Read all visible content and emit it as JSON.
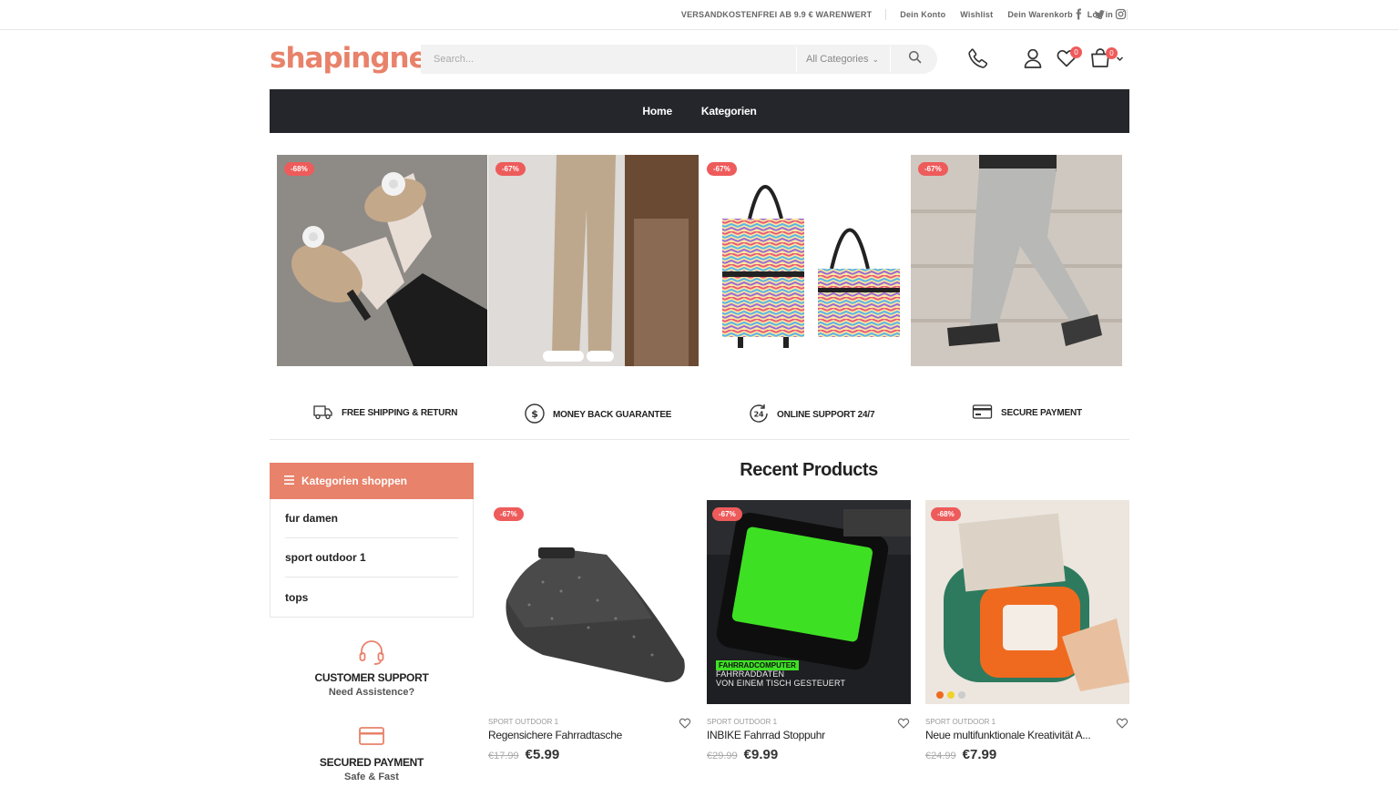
{
  "topbar": {
    "shipping_notice": "VERSANDKOSTENFREI AB 9.9 € WARENWERT",
    "links": [
      "Dein Konto",
      "Wishlist",
      "Dein Warenkorb",
      "Log in"
    ],
    "social_icons": [
      "facebook-icon",
      "twitter-icon",
      "instagram-icon"
    ]
  },
  "header": {
    "logo_text": "shapingnew",
    "search_placeholder": "Search...",
    "category_select": "All Categories",
    "wishlist_count": "0",
    "cart_count": "0"
  },
  "nav": {
    "items": [
      "Home",
      "Kategorien"
    ]
  },
  "banners": [
    {
      "discount": "-68%"
    },
    {
      "discount": "-67%"
    },
    {
      "discount": "-67%"
    },
    {
      "discount": "-67%"
    }
  ],
  "features": [
    {
      "label": "FREE SHIPPING & RETURN",
      "icon": "truck-icon"
    },
    {
      "label": "MONEY BACK GUARANTEE",
      "icon": "dollar-circle-icon"
    },
    {
      "label": "ONLINE SUPPORT 24/7",
      "icon": "support-24-icon"
    },
    {
      "label": "SECURE PAYMENT",
      "icon": "payment-card-icon"
    }
  ],
  "sidebar": {
    "heading": "Kategorien shoppen",
    "categories": [
      "fur damen",
      "sport outdoor 1",
      "tops"
    ],
    "support": {
      "title": "CUSTOMER SUPPORT",
      "subtitle": "Need Assistence?"
    },
    "payment": {
      "title": "SECURED PAYMENT",
      "subtitle": "Safe & Fast"
    }
  },
  "products": {
    "section_title": "Recent Products",
    "items": [
      {
        "discount": "-67%",
        "category": "SPORT OUTDOOR 1",
        "name": "Regensichere Fahrradtasche",
        "old_price": "€17.99",
        "price": "€5.99"
      },
      {
        "discount": "-67%",
        "category": "SPORT OUTDOOR 1",
        "name": "INBIKE Fahrrad Stoppuhr",
        "old_price": "€29.99",
        "price": "€9.99",
        "image_text": [
          "FAHRRADCOMPUTER",
          "FAHRRADDATEN",
          "VON EINEM TISCH GESTEUERT"
        ]
      },
      {
        "discount": "-68%",
        "category": "SPORT OUTDOOR 1",
        "name": "Neue multifunktionale Kreativität A...",
        "old_price": "€24.99",
        "price": "€7.99"
      }
    ]
  },
  "colors": {
    "brand": "#e8826a",
    "nav_bg": "#24262b",
    "badge": "#ee5b5b"
  }
}
